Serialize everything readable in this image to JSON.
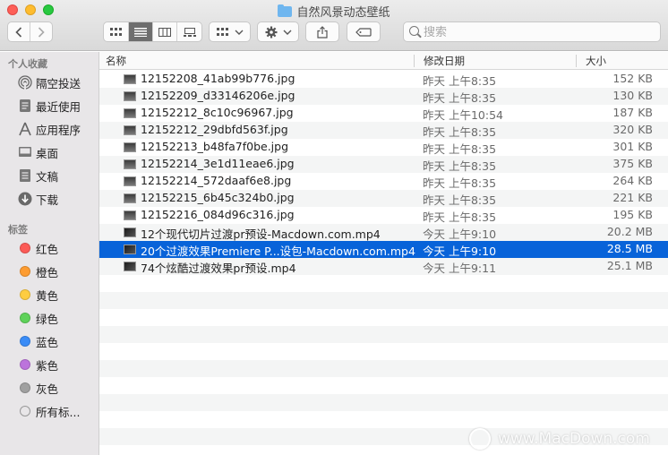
{
  "window": {
    "title": "自然风景动态壁纸"
  },
  "toolbar": {
    "back_icon": "chevron-left-icon",
    "forward_icon": "chevron-right-icon",
    "view_modes": [
      "icon-view-icon",
      "list-view-icon",
      "column-view-icon",
      "gallery-view-icon"
    ],
    "active_view": "list-view-icon",
    "search_placeholder": "搜索"
  },
  "sidebar": {
    "favorites_header": "个人收藏",
    "favorites": [
      {
        "label": "隔空投送",
        "icon": "airdrop-icon"
      },
      {
        "label": "最近使用",
        "icon": "recents-icon"
      },
      {
        "label": "应用程序",
        "icon": "applications-icon"
      },
      {
        "label": "桌面",
        "icon": "desktop-icon"
      },
      {
        "label": "文稿",
        "icon": "documents-icon"
      },
      {
        "label": "下载",
        "icon": "downloads-icon"
      }
    ],
    "tags_header": "标签",
    "tags": [
      {
        "label": "红色",
        "color": "#fc5b57"
      },
      {
        "label": "橙色",
        "color": "#fd9c31"
      },
      {
        "label": "黄色",
        "color": "#fecd41"
      },
      {
        "label": "绿色",
        "color": "#5fd25a"
      },
      {
        "label": "蓝色",
        "color": "#3a8cf7"
      },
      {
        "label": "紫色",
        "color": "#bc73dc"
      },
      {
        "label": "灰色",
        "color": "#a0a0a0"
      },
      {
        "label": "所有标...",
        "color": "#e8e6e8"
      }
    ]
  },
  "columns": {
    "name": "名称",
    "date": "修改日期",
    "size": "大小"
  },
  "files": [
    {
      "name": "12152208_41ab99b776.jpg",
      "date": "昨天 上午8:35",
      "size": "152 KB",
      "kind": "image"
    },
    {
      "name": "12152209_d33146206e.jpg",
      "date": "昨天 上午8:35",
      "size": "130 KB",
      "kind": "image"
    },
    {
      "name": "12152212_8c10c96967.jpg",
      "date": "昨天 上午10:54",
      "size": "187 KB",
      "kind": "image"
    },
    {
      "name": "12152212_29dbfd563f.jpg",
      "date": "昨天 上午8:35",
      "size": "320 KB",
      "kind": "image"
    },
    {
      "name": "12152213_b48fa7f0be.jpg",
      "date": "昨天 上午8:35",
      "size": "301 KB",
      "kind": "image"
    },
    {
      "name": "12152214_3e1d11eae6.jpg",
      "date": "昨天 上午8:35",
      "size": "375 KB",
      "kind": "image"
    },
    {
      "name": "12152214_572daaf6e8.jpg",
      "date": "昨天 上午8:35",
      "size": "264 KB",
      "kind": "image"
    },
    {
      "name": "12152215_6b45c324b0.jpg",
      "date": "昨天 上午8:35",
      "size": "221 KB",
      "kind": "image"
    },
    {
      "name": "12152216_084d96c316.jpg",
      "date": "昨天 上午8:35",
      "size": "195 KB",
      "kind": "image"
    },
    {
      "name": "12个现代切片过渡pr预设-Macdown.com.mp4",
      "date": "今天 上午9:10",
      "size": "20.2 MB",
      "kind": "video"
    },
    {
      "name": "20个过渡效果Premiere P...设包-Macdown.com.mp4",
      "date": "今天 上午9:10",
      "size": "28.5 MB",
      "kind": "video",
      "selected": true
    },
    {
      "name": "74个炫酷过渡效果pr预设.mp4",
      "date": "今天 上午9:11",
      "size": "25.1 MB",
      "kind": "video"
    }
  ],
  "watermark": "www.MacDown.com",
  "empty_rows": 10
}
